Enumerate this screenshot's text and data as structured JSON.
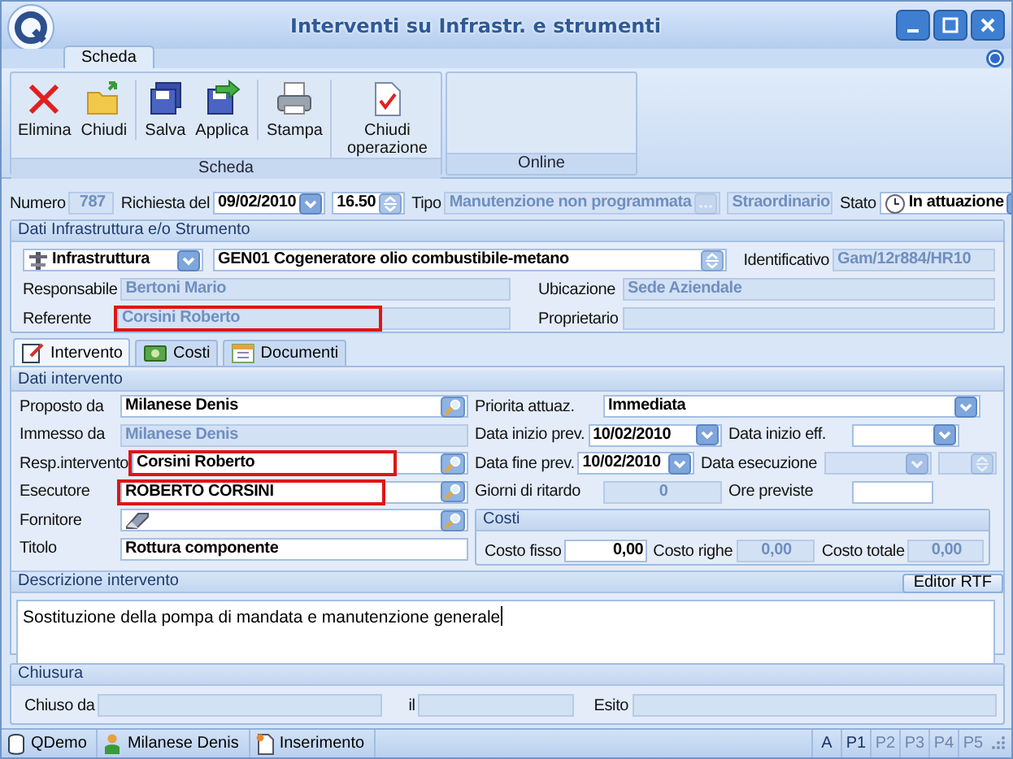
{
  "window": {
    "title": "Interventi su Infrastr. e strumenti"
  },
  "ribbon": {
    "tabs": [
      {
        "label": "Scheda",
        "selected": true
      }
    ],
    "groups": [
      {
        "label": "Scheda",
        "buttons": [
          {
            "label": "Elimina",
            "kind": "delete",
            "separator_before": false
          },
          {
            "label": "Chiudi",
            "kind": "close",
            "separator_before": false
          },
          {
            "label": "Salva",
            "kind": "save",
            "separator_before": true
          },
          {
            "label": "Applica",
            "kind": "apply",
            "separator_before": false
          },
          {
            "label": "Stampa",
            "kind": "print",
            "separator_before": true
          },
          {
            "label": "Chiudi operazione",
            "kind": "finish",
            "separator_before": true
          }
        ]
      },
      {
        "label": "Online"
      }
    ]
  },
  "header": [
    {
      "label": "Numero",
      "value": "787",
      "kind": "number",
      "disabled": true
    },
    {
      "label": "Richiesta del",
      "value": "09/02/2010",
      "kind": "date",
      "disabled": false
    },
    {
      "value": "16.50",
      "kind": "spin",
      "disabled": false
    },
    {
      "label": "Tipo",
      "value": "Manutenzione non programmata",
      "kind": "ellipsis",
      "disabled": true
    },
    {
      "value": "Straordinario",
      "kind": "text",
      "disabled": true
    },
    {
      "label": "Stato",
      "value": "In attuazione",
      "kind": "status-combo",
      "disabled": false
    }
  ],
  "infrastructure": {
    "title": "Dati Infrastruttura e/o Strumento",
    "rows": [
      [
        {
          "value": "Infrastruttura",
          "kind": "type-combo",
          "disabled": false
        },
        {
          "value": "GEN01 Cogeneratore olio combustibile-metano",
          "kind": "spin",
          "disabled": false
        },
        {
          "label": "Identificativo",
          "value": "Gam/12r884/HR10",
          "kind": "text",
          "disabled": true
        }
      ],
      [
        {
          "label": "Responsabile",
          "value": "Bertoni Mario",
          "kind": "text",
          "disabled": true
        },
        {
          "label": "Ubicazione",
          "value": "Sede Aziendale",
          "kind": "text",
          "disabled": true
        }
      ],
      [
        {
          "label": "Referente",
          "value": "Corsini Roberto",
          "kind": "text",
          "disabled": true,
          "highlighted": true
        },
        {
          "label": "Proprietario",
          "kind": "text",
          "disabled": true
        }
      ]
    ]
  },
  "tabs": [
    {
      "label": "Intervento",
      "selected": true
    },
    {
      "label": "Costi",
      "selected": false
    },
    {
      "label": "Documenti",
      "selected": false
    }
  ],
  "intervento": {
    "title": "Dati intervento",
    "left": [
      {
        "label": "Proposto da",
        "value": "Milanese Denis",
        "kind": "lookup",
        "disabled": false
      },
      {
        "label": "Immesso da",
        "value": "Milanese Denis",
        "kind": "text",
        "disabled": true
      },
      {
        "label": "Resp.intervento",
        "value": "Corsini Roberto",
        "kind": "lookup",
        "disabled": false,
        "highlighted": true
      },
      {
        "label": "Esecutore",
        "value": "ROBERTO CORSINI",
        "kind": "lookup",
        "disabled": false,
        "highlighted": true
      },
      {
        "label": "Fornitore",
        "kind": "lookup-clear",
        "disabled": false
      },
      {
        "label": "Titolo",
        "value": "Rottura componente",
        "kind": "text",
        "disabled": false
      }
    ],
    "right": [
      [
        {
          "label": "Priorita attuaz.",
          "value": "Immediata",
          "kind": "combo",
          "disabled": false
        }
      ],
      [
        {
          "label": "Data inizio prev.",
          "value": "10/02/2010",
          "kind": "date",
          "disabled": false
        },
        {
          "label": "Data inizio eff.",
          "kind": "date",
          "disabled": false
        }
      ],
      [
        {
          "label": "Data fine prev.",
          "value": "10/02/2010",
          "kind": "date",
          "disabled": false
        },
        {
          "label": "Data esecuzione",
          "kind": "date",
          "disabled": true
        },
        {
          "kind": "spin",
          "disabled": true
        }
      ],
      [
        {
          "label": "Giorni di ritardo",
          "value": "0",
          "kind": "number",
          "disabled": true
        },
        {
          "label": "Ore previste",
          "kind": "text",
          "disabled": false
        }
      ]
    ],
    "costs": {
      "title": "Costi",
      "fields": [
        {
          "label": "Costo fisso",
          "value": "0,00",
          "kind": "number",
          "disabled": false
        },
        {
          "label": "Costo righe",
          "value": "0,00",
          "kind": "number",
          "disabled": true
        },
        {
          "label": "Costo totale",
          "value": "0,00",
          "kind": "number",
          "disabled": true
        }
      ]
    }
  },
  "description": {
    "title": "Descrizione intervento",
    "button": "Editor RTF",
    "text": "Sostituzione della pompa di mandata e manutenzione generale"
  },
  "closing": {
    "title": "Chiusura",
    "fields": [
      {
        "label": "Chiuso da",
        "kind": "text",
        "disabled": true
      },
      {
        "label": "il",
        "kind": "text",
        "disabled": true
      },
      {
        "label": "Esito",
        "kind": "text",
        "disabled": true
      }
    ]
  },
  "status_bar": {
    "items": [
      {
        "label": "QDemo"
      },
      {
        "label": "Milanese Denis"
      },
      {
        "label": "Inserimento"
      }
    ],
    "indicators": [
      {
        "label": "A",
        "disabled": false
      },
      {
        "label": "P1",
        "disabled": false
      },
      {
        "label": "P2",
        "disabled": true
      },
      {
        "label": "P3",
        "disabled": true
      },
      {
        "label": "P4",
        "disabled": true
      },
      {
        "label": "P5",
        "disabled": true
      }
    ]
  }
}
